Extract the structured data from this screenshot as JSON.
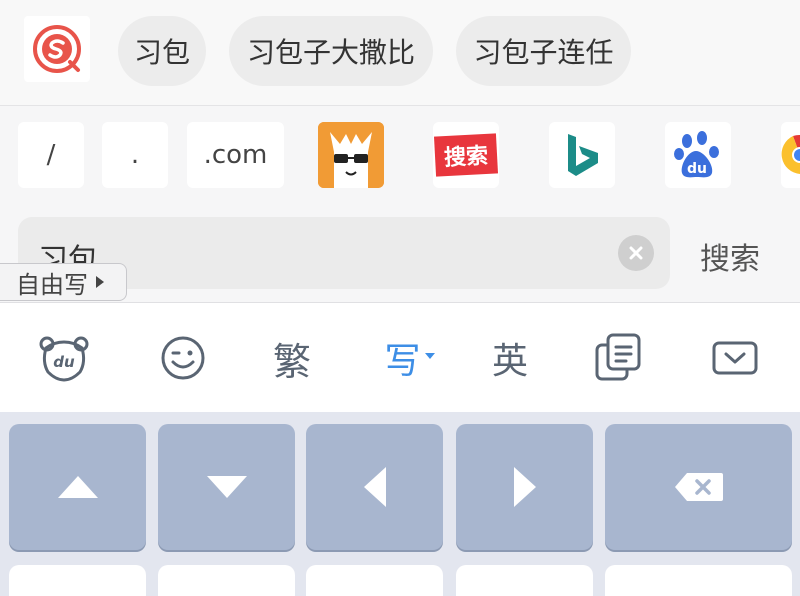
{
  "suggestions": {
    "items": [
      "习包",
      "习包子大撒比",
      "习包子连任"
    ]
  },
  "quick_inputs": {
    "slash": "/",
    "dot": ".",
    "com": ".com",
    "sites": [
      "site-icon-llama",
      "site-icon-sousuo",
      "site-icon-bing",
      "site-icon-baidu",
      "site-icon-chrome"
    ],
    "sousuo_label": "搜索",
    "baidu_label": "du"
  },
  "search": {
    "text": "习包",
    "button": "搜索",
    "freewrite_label": "自由写"
  },
  "toolbar": {
    "traditional": "繁",
    "write": "写",
    "english": "英",
    "du_label": "du"
  },
  "colors": {
    "accent_blue": "#3d8ee6",
    "function_key": "#a8b6cf",
    "sogou_red": "#e8544a"
  }
}
